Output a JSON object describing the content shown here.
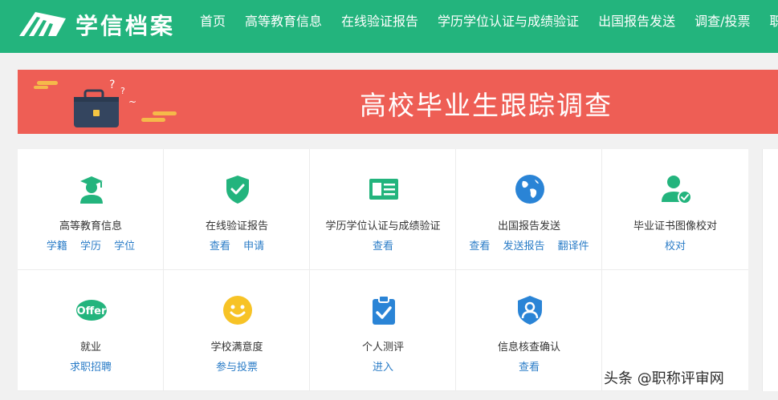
{
  "header": {
    "brand": "学信档案",
    "nav": [
      "首页",
      "高等教育信息",
      "在线验证报告",
      "学历学位认证与成绩验证",
      "出国报告发送",
      "调查/投票",
      "职"
    ]
  },
  "banner": {
    "title": "高校毕业生跟踪调查"
  },
  "services": [
    {
      "title": "高等教育信息",
      "links": [
        "学籍",
        "学历",
        "学位"
      ],
      "icon": "graduate-icon"
    },
    {
      "title": "在线验证报告",
      "links": [
        "查看",
        "申请"
      ],
      "icon": "shield-check-icon"
    },
    {
      "title": "学历学位认证与成绩验证",
      "links": [
        "查看"
      ],
      "icon": "certificate-card-icon"
    },
    {
      "title": "出国报告发送",
      "links": [
        "查看",
        "发送报告",
        "翻译件"
      ],
      "icon": "globe-icon"
    },
    {
      "title": "毕业证书图像校对",
      "links": [
        "校对"
      ],
      "icon": "user-check-icon"
    },
    {
      "title": "就业",
      "links": [
        "求职招聘"
      ],
      "icon": "offer-badge-icon",
      "badge": "Offer"
    },
    {
      "title": "学校满意度",
      "links": [
        "参与投票"
      ],
      "icon": "smiley-icon"
    },
    {
      "title": "个人测评",
      "links": [
        "进入"
      ],
      "icon": "clipboard-check-icon"
    },
    {
      "title": "信息核查确认",
      "links": [
        "查看"
      ],
      "icon": "user-shield-icon"
    }
  ],
  "watermark": "头条 @职称评审网",
  "colors": {
    "header": "#23b47d",
    "banner": "#ee5e55",
    "link": "#2a7cc7",
    "icon_green": "#23b47d",
    "icon_blue": "#2a84d6",
    "icon_yellow": "#f7c326"
  }
}
